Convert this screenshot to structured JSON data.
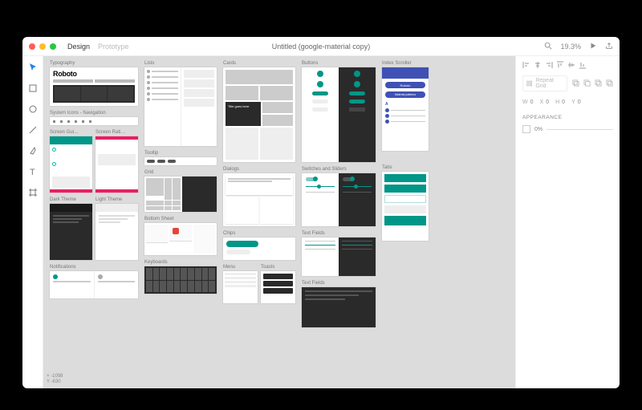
{
  "window": {
    "title": "Untitled (google-material copy)",
    "mode_tabs": {
      "design": "Design",
      "prototype": "Prototype"
    },
    "zoom": "19.3%"
  },
  "tools": [
    "select",
    "rectangle",
    "ellipse",
    "line",
    "pen",
    "text",
    "artboard"
  ],
  "status": {
    "x": "-1098",
    "y": "-630"
  },
  "inspector": {
    "repeat_grid": "Repeat Grid",
    "dims": {
      "w_label": "W",
      "w": "0",
      "x_label": "X",
      "x": "0",
      "h_label": "H",
      "h": "0",
      "y_label": "Y",
      "y": "0"
    },
    "appearance_label": "APPEARANCE",
    "opacity": "0%"
  },
  "artboards": {
    "typography": "Typography",
    "roboto": "Roboto",
    "sys_icons": "System Icons - Navigation",
    "screen_gui": "Screen Gui…",
    "screen_rat": "Screen Rati…",
    "dark_theme": "Dark Theme",
    "light_theme": "Light Theme",
    "notifications": "Notifications",
    "lists": "Lists",
    "tooltip": "Tooltip",
    "grid": "Grid",
    "bottom_sheet": "Bottom Sheet",
    "keyboards": "Keyboards",
    "cards": "Cards",
    "dialogs": "Dialogs",
    "chips": "Chips",
    "menu": "Menu",
    "toasts": "Toasts",
    "buttons": "Buttons",
    "switches": "Switches and Sliders",
    "text_fields": "Text Fields",
    "text_fields2": "Text Fields",
    "index_scroller": "Index Scroller",
    "tabs": "Tabs",
    "chip_label": "Roboto",
    "chip_label2": "Material patterns"
  }
}
